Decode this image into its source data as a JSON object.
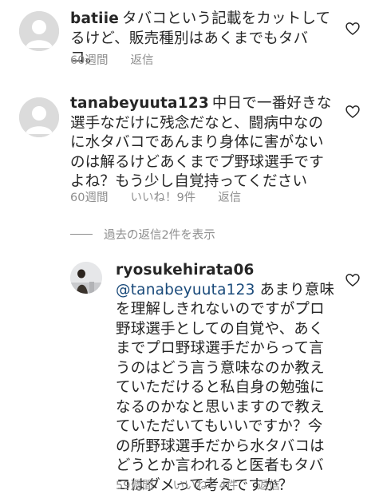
{
  "comments": [
    {
      "username": "batiie",
      "text": "タバコという記載をカットしてるけど、販売種別はあくまでもタバコ。",
      "age": "60週間",
      "likes": "",
      "reply": "返信",
      "avatar": "default-avatar"
    },
    {
      "username": "tanabeyuuta123",
      "text": "中日で一番好きな選手なだけに残念だなと、闘病中なのに水タバコであんまり身体に害がないのは解るけどあくまでプ野球選手ですよね？もう少し自覚持ってください",
      "age": "60週間",
      "likes": "いいね！9件",
      "reply": "返信",
      "avatar": "default-avatar"
    }
  ],
  "view_replies": "過去の返信2件を表示",
  "reply_comment": {
    "username": "ryosukehirata06",
    "mention": "@tanabeyuuta123",
    "text": "あまり意味を理解しきれないのですがプロ野球選手としての自覚や、あくまでプロ野球選手だからって言うのはどう言う意味なのか教えていただけると私自身の勉強になるのかなと思いますので教えていただいてもいいですか？今の所野球選手だから水タバコはどうとか言われると医者もタバコはダメって考えですか？",
    "age": "59週間",
    "likes": "いいね！4件",
    "reply": "返信",
    "avatar": "photo-avatar"
  },
  "colors": {
    "text": "#262626",
    "secondary": "#8e8e8e",
    "mention": "#1a4a7a",
    "avatar_placeholder": "#dbdbdb"
  }
}
